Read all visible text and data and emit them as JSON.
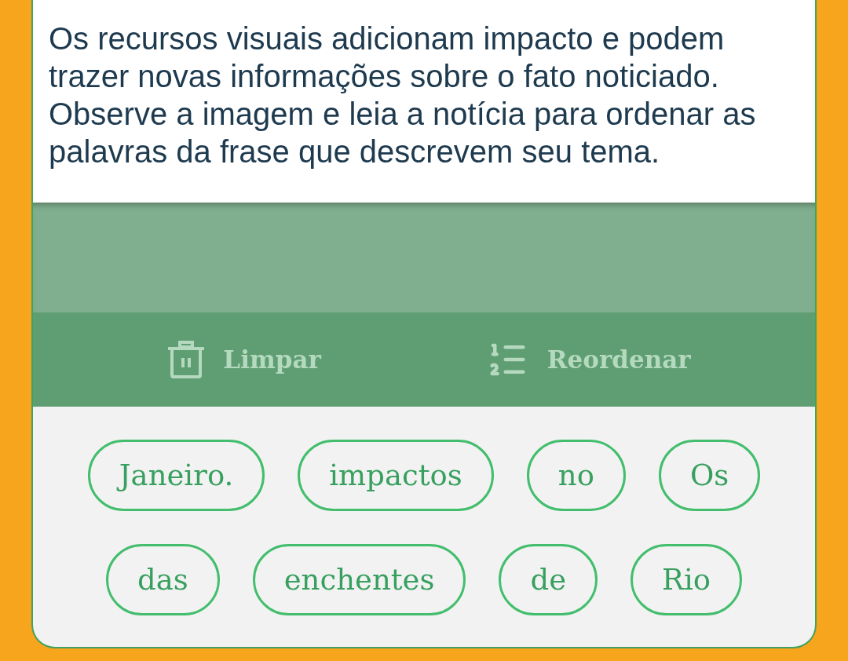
{
  "instructions": {
    "text": "Os recursos visuais adicionam impacto e podem trazer novas informações sobre o fato noticiado. Observe a imagem e leia a notícia para ordenar as palavras da frase que descrevem seu tema."
  },
  "toolbar": {
    "buttons": [
      {
        "kind": "clear",
        "label": "Limpar",
        "disabled": true
      },
      {
        "kind": "reorder",
        "label": "Reordenar",
        "disabled": true
      }
    ]
  },
  "word_bank": {
    "rows": [
      [
        "Janeiro.",
        "impactos",
        "no",
        "Os"
      ],
      [
        "das",
        "enchentes",
        "de",
        "Rio"
      ]
    ]
  }
}
